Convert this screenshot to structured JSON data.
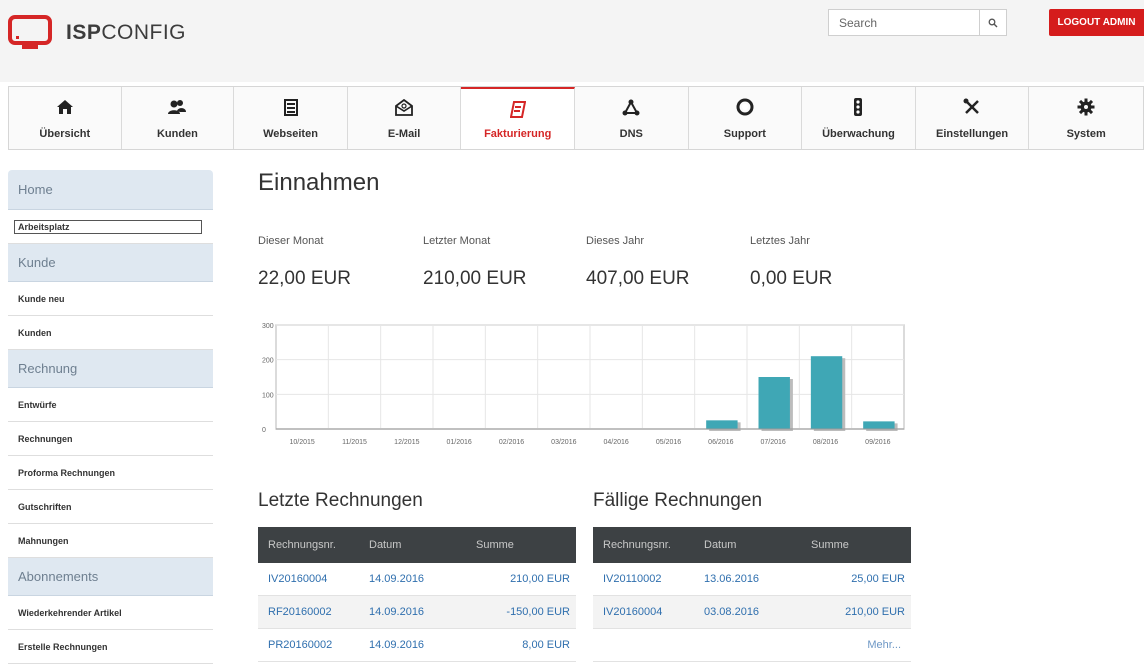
{
  "header": {
    "logo_text_bold": "ISP",
    "logo_text_light": "CONFIG",
    "search_placeholder": "Search",
    "logout_label": "LOGOUT ADMIN"
  },
  "nav": {
    "items": [
      {
        "label": "Übersicht",
        "icon": "home-icon"
      },
      {
        "label": "Kunden",
        "icon": "users-icon"
      },
      {
        "label": "Webseiten",
        "icon": "web-icon"
      },
      {
        "label": "E-Mail",
        "icon": "mail-icon"
      },
      {
        "label": "Fakturierung",
        "icon": "invoice-icon",
        "active": true
      },
      {
        "label": "DNS",
        "icon": "dns-icon"
      },
      {
        "label": "Support",
        "icon": "lifebuoy-icon"
      },
      {
        "label": "Überwachung",
        "icon": "traffic-light-icon"
      },
      {
        "label": "Einstellungen",
        "icon": "tools-icon"
      },
      {
        "label": "System",
        "icon": "gear-icon"
      }
    ]
  },
  "sidebar": {
    "home": "Home",
    "arbeitsplatz": "Arbeitsplatz",
    "kunde": "Kunde",
    "kunde_neu": "Kunde neu",
    "kunden": "Kunden",
    "rechnung": "Rechnung",
    "entwuerfe": "Entwürfe",
    "rechnungen": "Rechnungen",
    "proforma": "Proforma Rechnungen",
    "gutschriften": "Gutschriften",
    "mahnungen": "Mahnungen",
    "abonnements": "Abonnements",
    "wiederkehrend": "Wiederkehrender Artikel",
    "erstelle": "Erstelle Rechnungen"
  },
  "main": {
    "title": "Einnahmen",
    "stats": [
      {
        "label": "Dieser Monat",
        "value": "22,00 EUR"
      },
      {
        "label": "Letzter Monat",
        "value": "210,00 EUR"
      },
      {
        "label": "Dieses Jahr",
        "value": "407,00 EUR"
      },
      {
        "label": "Letztes Jahr",
        "value": "0,00 EUR"
      }
    ]
  },
  "chart_data": {
    "type": "bar",
    "categories": [
      "10/2015",
      "11/2015",
      "12/2015",
      "01/2016",
      "02/2016",
      "03/2016",
      "04/2016",
      "05/2016",
      "06/2016",
      "07/2016",
      "08/2016",
      "09/2016"
    ],
    "values": [
      0,
      0,
      0,
      0,
      0,
      0,
      0,
      0,
      25,
      150,
      210,
      22
    ],
    "ylim": [
      0,
      300
    ],
    "yticks": [
      0,
      100,
      200,
      300
    ],
    "grid": true,
    "bar_color": "#3fa7b5"
  },
  "tables": {
    "latest": {
      "title": "Letzte Rechnungen",
      "headers": [
        "Rechnungsnr.",
        "Datum",
        "Summe"
      ],
      "rows": [
        [
          "IV20160004",
          "14.09.2016",
          "210,00 EUR"
        ],
        [
          "RF20160002",
          "14.09.2016",
          "-150,00 EUR"
        ],
        [
          "PR20160002",
          "14.09.2016",
          "8,00 EUR"
        ]
      ]
    },
    "due": {
      "title": "Fällige Rechnungen",
      "headers": [
        "Rechnungsnr.",
        "Datum",
        "Summe"
      ],
      "rows": [
        [
          "IV20110002",
          "13.06.2016",
          "25,00 EUR"
        ],
        [
          "IV20160004",
          "03.08.2016",
          "210,00 EUR"
        ]
      ],
      "more": "Mehr..."
    }
  }
}
